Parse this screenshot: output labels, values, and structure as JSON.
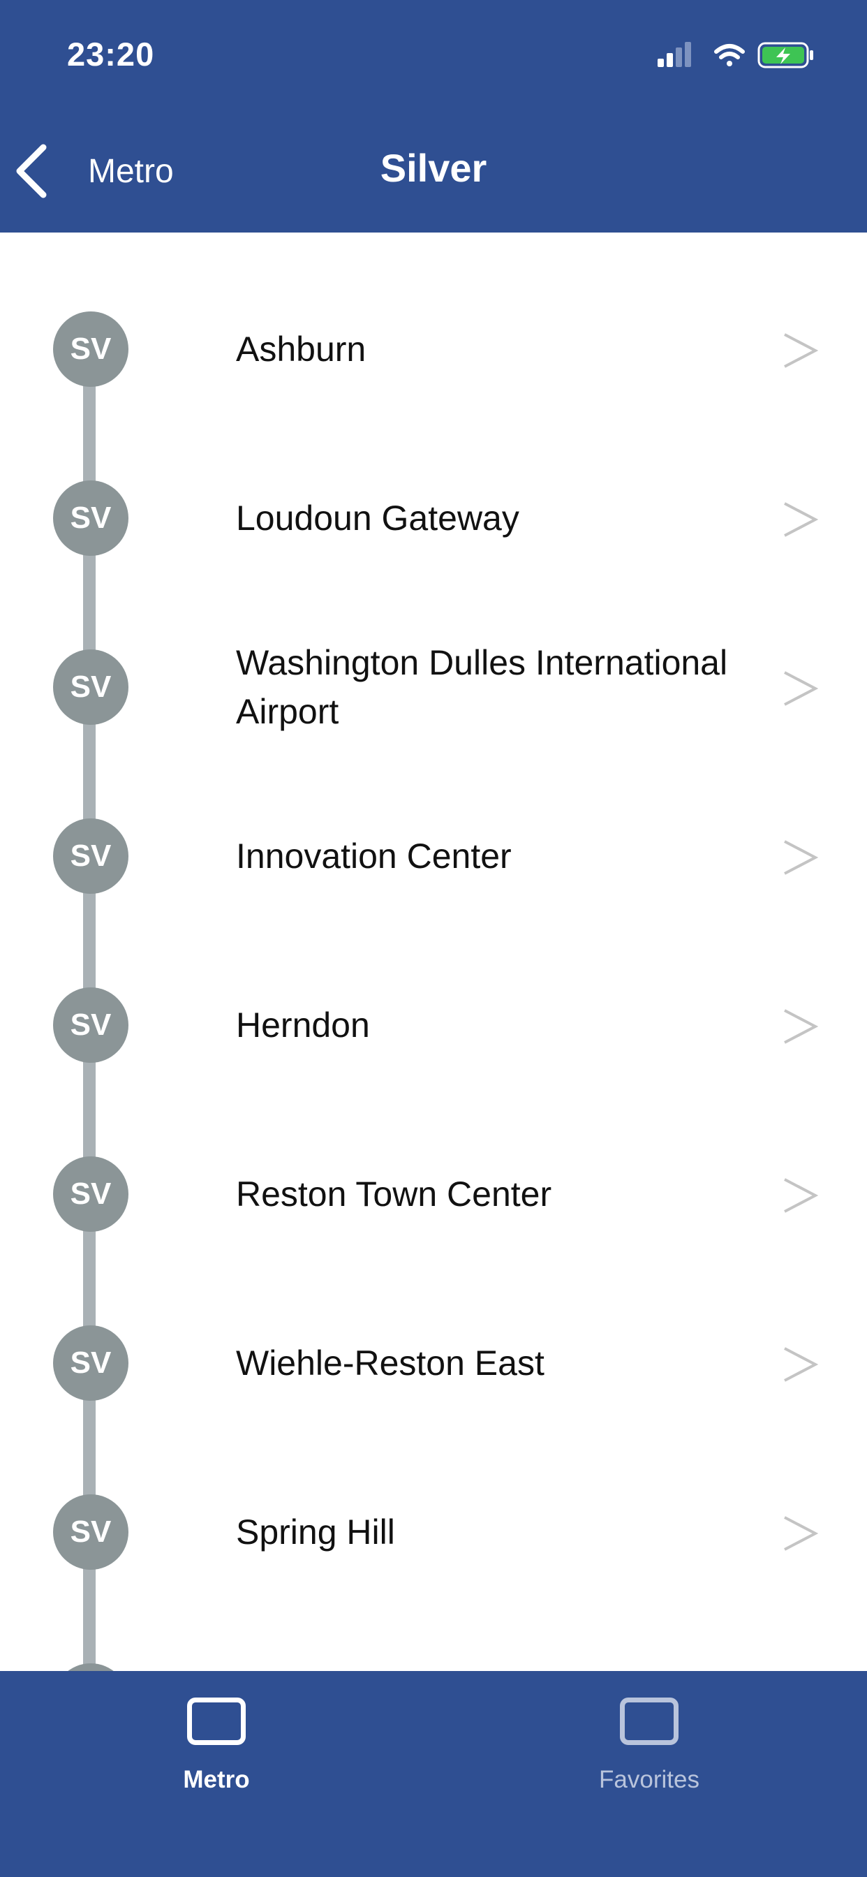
{
  "status_bar": {
    "time": "23:20"
  },
  "nav": {
    "back_label": "Metro",
    "title": "Silver"
  },
  "line": {
    "badge_label": "SV",
    "badge_color": "#8b9597",
    "rail_color": "#a9b1b5"
  },
  "stations": [
    {
      "name": "Ashburn"
    },
    {
      "name": "Loudoun Gateway"
    },
    {
      "name": "Washington Dulles International Airport"
    },
    {
      "name": "Innovation Center"
    },
    {
      "name": "Herndon"
    },
    {
      "name": "Reston Town Center"
    },
    {
      "name": "Wiehle-Reston East"
    },
    {
      "name": "Spring Hill"
    }
  ],
  "tabbar": {
    "metro_label": "Metro",
    "favorites_label": "Favorites"
  },
  "colors": {
    "brand": "#2f4f92",
    "battery": "#3ec454"
  }
}
